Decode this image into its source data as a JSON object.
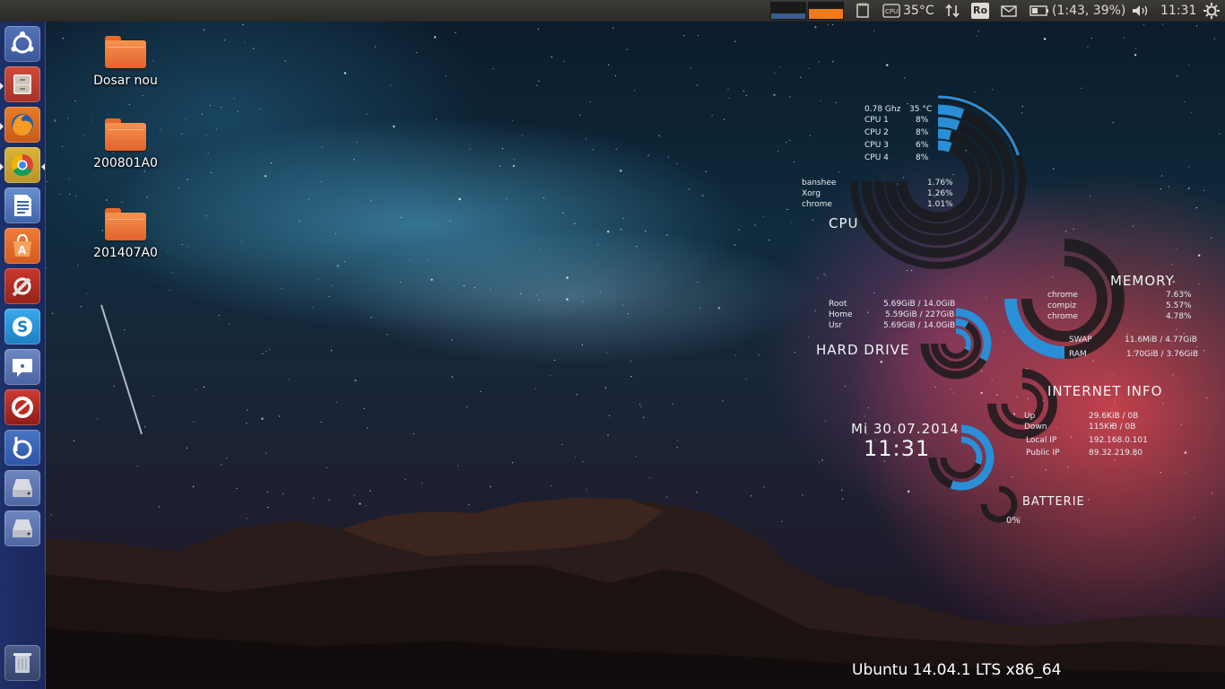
{
  "top_panel": {
    "cpu_temp": "35°C",
    "keyboard_layout": "Ro",
    "battery": "(1:43, 39%)",
    "clock": "11:31",
    "icons": [
      "system-monitor-graph",
      "notes-icon",
      "cpu-chip-icon",
      "network-arrows-icon",
      "keyboard-layout-icon",
      "mail-icon",
      "battery-icon",
      "volume-icon",
      "settings-gear-icon"
    ]
  },
  "launcher": {
    "items": [
      "ubuntu-dash",
      "files",
      "firefox",
      "chrome",
      "libreoffice-writer",
      "software-center",
      "system-settings",
      "skype",
      "empathy",
      "armagetron",
      "bleachbit",
      "drive-1",
      "drive-2",
      "trash"
    ]
  },
  "desktop": {
    "icons": [
      {
        "label": "Dosar nou"
      },
      {
        "label": "200801A0"
      },
      {
        "label": "201407A0"
      }
    ]
  },
  "conky": {
    "cpu": {
      "title": "CPU",
      "freq": "0.78 Ghz",
      "temp": "35 °C",
      "cores": [
        {
          "name": "CPU 1",
          "value": "8%"
        },
        {
          "name": "CPU 2",
          "value": "8%"
        },
        {
          "name": "CPU 3",
          "value": "6%"
        },
        {
          "name": "CPU 4",
          "value": "8%"
        }
      ],
      "processes": [
        {
          "name": "banshee",
          "value": "1.76%"
        },
        {
          "name": "Xorg",
          "value": "1.26%"
        },
        {
          "name": "chrome",
          "value": "1.01%"
        }
      ]
    },
    "memory": {
      "title": "MEMORY",
      "processes": [
        {
          "name": "chrome",
          "value": "7.63%"
        },
        {
          "name": "compiz",
          "value": "5.57%"
        },
        {
          "name": "chrome",
          "value": "4.78%"
        }
      ],
      "swap_label": "SWAP",
      "swap_value": "11.6MiB / 4.77GiB",
      "ram_label": "RAM",
      "ram_value": "1.70GiB / 3.76GiB"
    },
    "hard_drive": {
      "title": "HARD DRIVE",
      "mounts": [
        {
          "name": "Root",
          "value": "5.69GiB / 14.0GiB"
        },
        {
          "name": "Home",
          "value": "5.59GiB / 227GiB"
        },
        {
          "name": "Usr",
          "value": "5.69GiB / 14.0GiB"
        }
      ]
    },
    "internet": {
      "title": "INTERNET INFO",
      "up_label": "Up",
      "up_value": "29.6KiB / 0B",
      "down_label": "Down",
      "down_value": "115KiB / 0B",
      "local_label": "Local IP",
      "local_value": "192.168.0.101",
      "public_label": "Public IP",
      "public_value": "89.32.219.80"
    },
    "clock": {
      "date": "Mi 30.07.2014",
      "time": "11:31"
    },
    "battery": {
      "title": "BATTERIE",
      "value": "0%"
    },
    "os": "Ubuntu 14.04.1 LTS x86_64"
  },
  "colors": {
    "conky_accent": "#2a8fd6",
    "conky_ring": "#1a1a1c",
    "panel_bg": "#3c3b37",
    "launcher_bg": "#1f3570",
    "folder_orange": "#f0793a"
  }
}
